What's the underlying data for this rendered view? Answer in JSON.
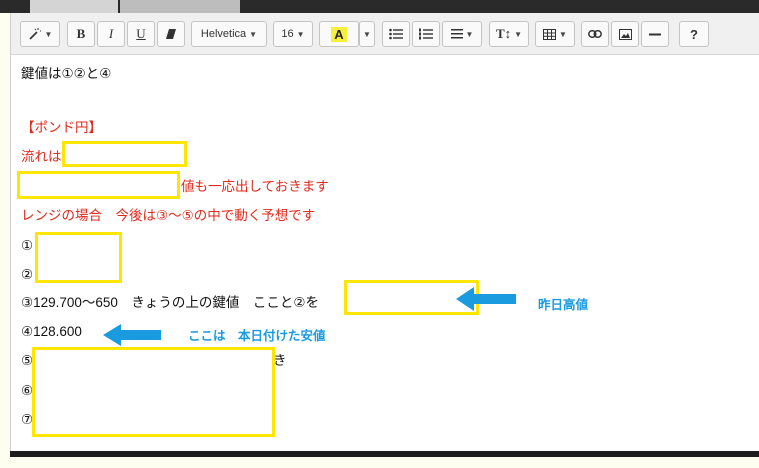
{
  "toolbar": {
    "bold_label": "B",
    "italic_label": "I",
    "underline_label": "U",
    "font_name": "Helvetica",
    "font_size": "16",
    "highlight_label": "A",
    "text_height_label": "T↕",
    "help_label": "?"
  },
  "content": {
    "line1": "鍵値は①②と④",
    "heading": "【ポンド円】",
    "flow_prefix": "流れは",
    "value_suffix": "値も一応出しておきます",
    "range_text": "レンジの場合　今後は③～⑤の中で動く予想です",
    "item1": "①",
    "item2": "②",
    "item3": "③129.700～650　きょうの上の鍵値　ここと②を",
    "item4": "④128.600",
    "item5_num": "⑤",
    "item5_tail": "き",
    "item6_num": "⑥",
    "item7_num": "⑦"
  },
  "notes": {
    "yesterday_high": "昨日高値",
    "today_low": "ここは　本日付けた安値"
  },
  "colors": {
    "highlight_box": "#ffe600",
    "annotation_blue": "#1a9be0",
    "red_text": "#e12a1d"
  }
}
